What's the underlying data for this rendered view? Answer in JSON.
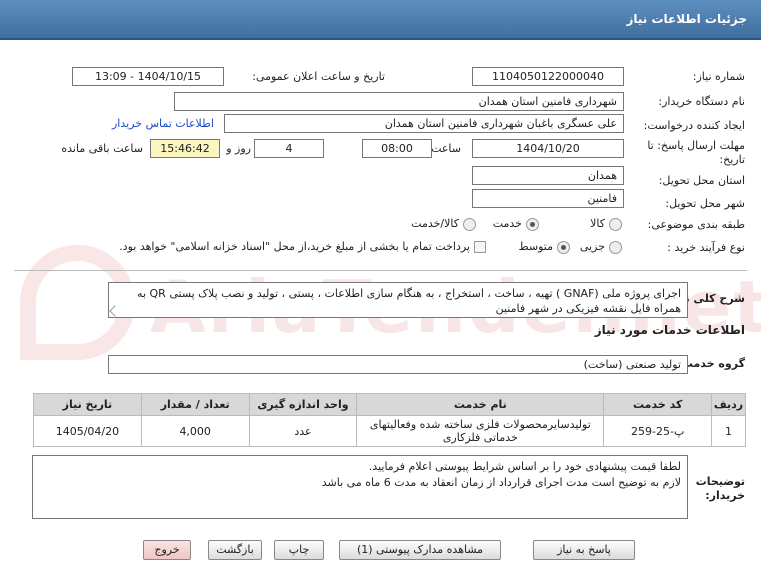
{
  "header": {
    "title": "جزئیات اطلاعات نیاز"
  },
  "form": {
    "need_number_label": "شماره نیاز:",
    "need_number": "1104050122000040",
    "announce_label": "تاریخ و ساعت اعلان عمومی:",
    "announce_value": "1404/10/15 - 13:09",
    "buyer_org_label": "نام دستگاه خریدار:",
    "buyer_org": "شهرداری فامنین استان همدان",
    "requester_label": "ایجاد کننده درخواست:",
    "requester": "علی عسگری باغبان شهرداری فامنین استان همدان",
    "contact_link": "اطلاعات تماس خریدار",
    "deadline_label": "مهلت ارسال پاسخ: تا",
    "deadline_label2": "تاریخ:",
    "deadline_date": "1404/10/20",
    "time_label": "ساعت",
    "deadline_time": "08:00",
    "days_value": "4",
    "days_label": "روز و",
    "remaining_time": "15:46:42",
    "remaining_label": "ساعت باقی مانده",
    "province_label": "استان محل تحویل:",
    "province": "همدان",
    "city_label": "شهر محل تحویل:",
    "city": "فامنین",
    "category_label": "طبقه بندی موضوعی:",
    "category_options": [
      "کالا",
      "خدمت",
      "کالا/خدمت"
    ],
    "category_selected": 1,
    "process_label": "نوع فرآیند خرید :",
    "process_options": [
      "جزیی",
      "متوسط"
    ],
    "process_selected": 1,
    "payment_text": "پرداخت تمام یا بخشی از مبلغ خرید،از محل \"اسناد خزانه اسلامی\" خواهد بود."
  },
  "description": {
    "label": "شرح کلی نیاز:",
    "text": "اجرای پروژه ملی (GNAF ) تهیه ، ساخت ، استخراج ، به هنگام سازی اطلاعات ، پستی ، تولید و نصب پلاک پستی QR به همراه فایل نقشه فیزیکی در شهر فامنین"
  },
  "services": {
    "section_title": "اطلاعات خدمات مورد نیاز",
    "group_label": "گروه خدمت:",
    "group_value": "تولید صنعتی (ساخت)",
    "columns": [
      "ردیف",
      "کد خدمت",
      "نام خدمت",
      "واحد اندازه گیری",
      "تعداد / مقدار",
      "تاریخ نیاز"
    ],
    "rows": [
      {
        "row": "1",
        "code": "پ-25-259",
        "name": "تولیدسایرمحصولات فلزی ساخته شده وفعالیتهای خدماتی فلزکاری",
        "unit": "عدد",
        "qty": "4,000",
        "date": "1405/04/20"
      }
    ]
  },
  "notes": {
    "label": "توضیحات",
    "label2": "خریدار:",
    "line1": "لطفا قیمت پیشنهادی خود را بر اساس شرایط پیوستی اعلام فرمایید.",
    "line2": "لازم به توضیح است مدت اجرای قرارداد از زمان انعقاد به مدت 6 ماه می باشد"
  },
  "buttons": {
    "reply": "پاسخ به نیاز",
    "view_docs": "مشاهده مدارک پیوستی (1)",
    "print": "چاپ",
    "back": "بازگشت",
    "exit": "خروج"
  },
  "watermark": {
    "text": "AriaTender.net"
  },
  "colors": {
    "header": "#4a7bab",
    "link": "#1a49c9",
    "yellow_box": "#fbf5bf"
  }
}
